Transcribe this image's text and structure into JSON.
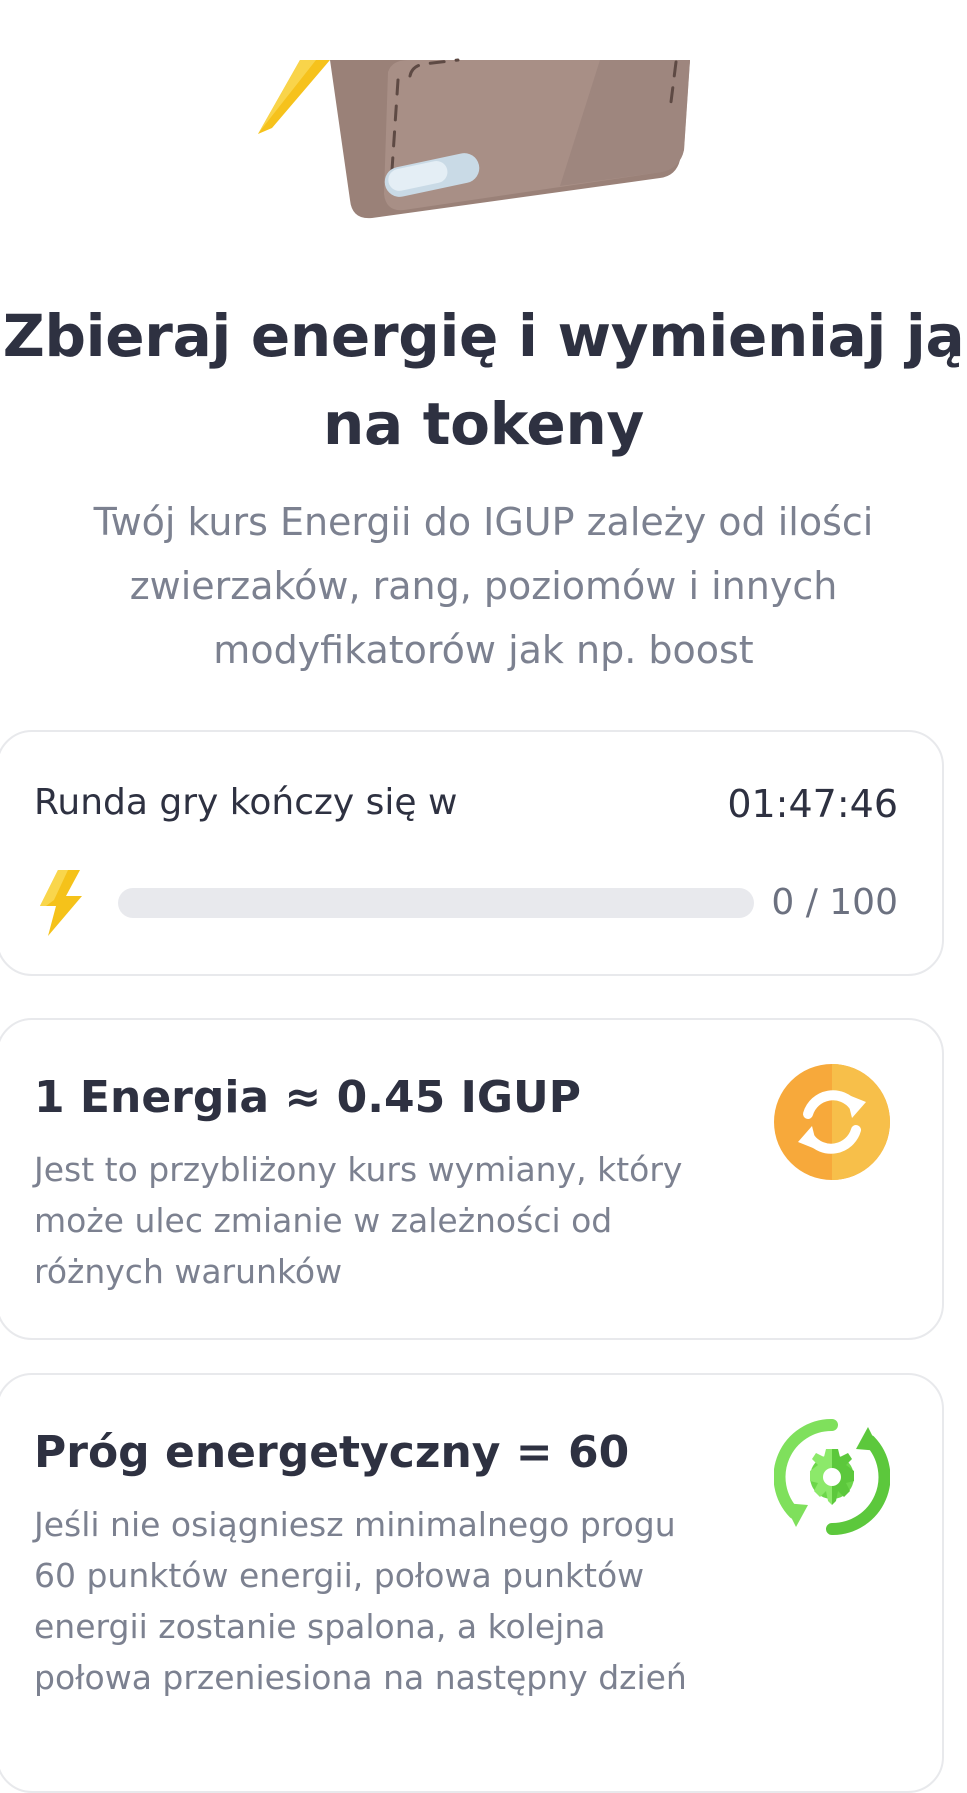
{
  "header": {
    "title_line1": "Zbieraj energię i wymieniaj ją",
    "title_line2": "na tokeny",
    "subtitle_line1": "Twój kurs Energii do IGUP zależy od ilości",
    "subtitle_line2": "zwierzaków, rang, poziomów i innych",
    "subtitle_line3": "modyfikatorów jak np. boost"
  },
  "round": {
    "label": "Runda gry kończy się w",
    "timer": "01:47:46",
    "progress_text": "0 / 100",
    "progress_value": 0,
    "progress_max": 100
  },
  "rate": {
    "title": "1 Energia ≈ 0.45 IGUP",
    "desc_line1": "Jest to przybliżony kurs wymiany, który",
    "desc_line2": "może ulec zmianie w zależności od",
    "desc_line3": "różnych warunków",
    "icon": "exchange-icon"
  },
  "threshold": {
    "title": "Próg energetyczny = 60",
    "desc_line1": "Jeśli nie osiągniesz minimalnego progu",
    "desc_line2": "60 punktów energii, połowa punktów",
    "desc_line3": "energii zostanie spalona, a kolejna",
    "desc_line4": "połowa przeniesiona na następny dzień",
    "icon": "recycle-gear-icon"
  },
  "colors": {
    "accent_orange": "#f7a93b",
    "accent_green": "#6cd64a",
    "bolt": "#f5c21a"
  }
}
